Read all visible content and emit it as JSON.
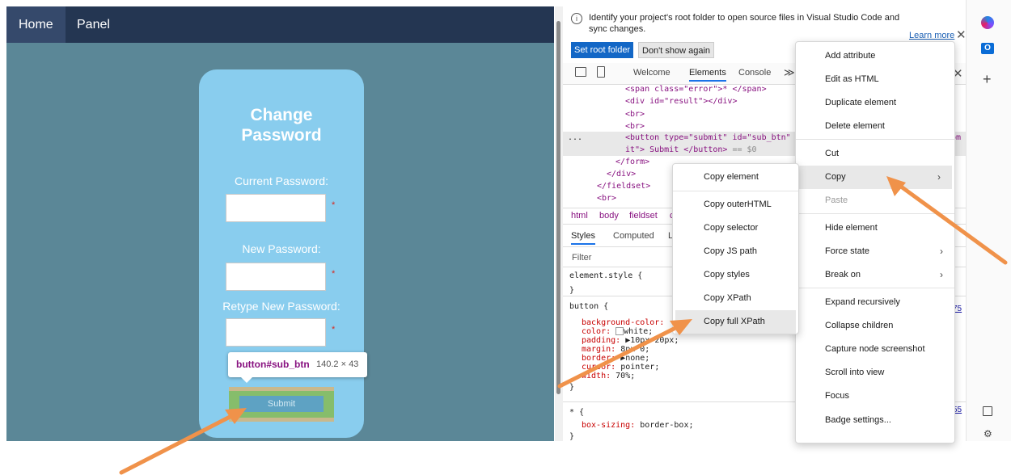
{
  "webpage": {
    "nav": {
      "home": "Home",
      "panel": "Panel"
    },
    "title_line1": "Change",
    "title_line2": "Password",
    "fields": [
      {
        "label": "Current Password:",
        "required": "*"
      },
      {
        "label": "New Password:",
        "required": "*"
      },
      {
        "label": "Retype New Password:",
        "required": "*"
      }
    ],
    "submit_label": "Submit",
    "tooltip": {
      "selector": "button#sub_btn",
      "size": "140.2 × 43"
    }
  },
  "devtools": {
    "infobar": {
      "text": "Identify your project's root folder to open source files in Visual Studio Code and sync changes.",
      "learn_more": "Learn more",
      "set_root": "Set root folder",
      "dont_show": "Don't show again"
    },
    "tabs": [
      "Welcome",
      "Elements",
      "Console"
    ],
    "overflow": "≫",
    "code": {
      "line1": "<span class=\"error\">* </span>",
      "line2": "<div id=\"result\"></div>",
      "line3": "<br>",
      "line4": "<br>",
      "line5a": "<button type=\"submit\" id=\"sub_btn\"",
      "line5b": "it\"> Submit </button>",
      "line5c": " == $0",
      "line5_tail": "bm",
      "line6": "</form>",
      "line7": "</div>",
      "line8": "</fieldset>",
      "line9": "<br>",
      "ellipsis": "..."
    },
    "breadcrumb": [
      "html",
      "body",
      "fieldset",
      "c"
    ],
    "style_tabs": [
      "Styles",
      "Computed",
      "L"
    ],
    "filter_placeholder": "Filter",
    "styles": {
      "element_style": "element.style {",
      "close1": "}",
      "button_sel": "button {",
      "bg": "background-color:",
      "color_prop": "color:",
      "color_val": "white;",
      "padding_prop": "padding:",
      "padding_val": "10px 20px;",
      "margin_prop": "margin:",
      "margin_val": "8px 0;",
      "border_prop": "border:",
      "border_val": "none;",
      "cursor_prop": "cursor:",
      "cursor_val": "pointer;",
      "width_prop": "width:",
      "width_val": "70%;",
      "close2": "}",
      "universal": "* {",
      "box_sizing_prop": "box-sizing:",
      "box_sizing_val": "border-box;",
      "close3": "}",
      "link1": "75",
      "link2": "55"
    }
  },
  "context_menu": {
    "items": [
      "Add attribute",
      "Edit as HTML",
      "Duplicate element",
      "Delete element",
      "Cut",
      "Copy",
      "Paste",
      "Hide element",
      "Force state",
      "Break on",
      "Expand recursively",
      "Collapse children",
      "Capture node screenshot",
      "Scroll into view",
      "Focus",
      "Badge settings..."
    ]
  },
  "copy_submenu": {
    "items": [
      "Copy element",
      "Copy outerHTML",
      "Copy selector",
      "Copy JS path",
      "Copy styles",
      "Copy XPath",
      "Copy full XPath"
    ]
  },
  "sidebar": {
    "outlook_letter": "O"
  },
  "colors": {
    "page_bg": "#5b8797",
    "navbar": "#243652",
    "card": "#89cdee",
    "arrow": "#f0924a",
    "accent": "#1367c6"
  }
}
